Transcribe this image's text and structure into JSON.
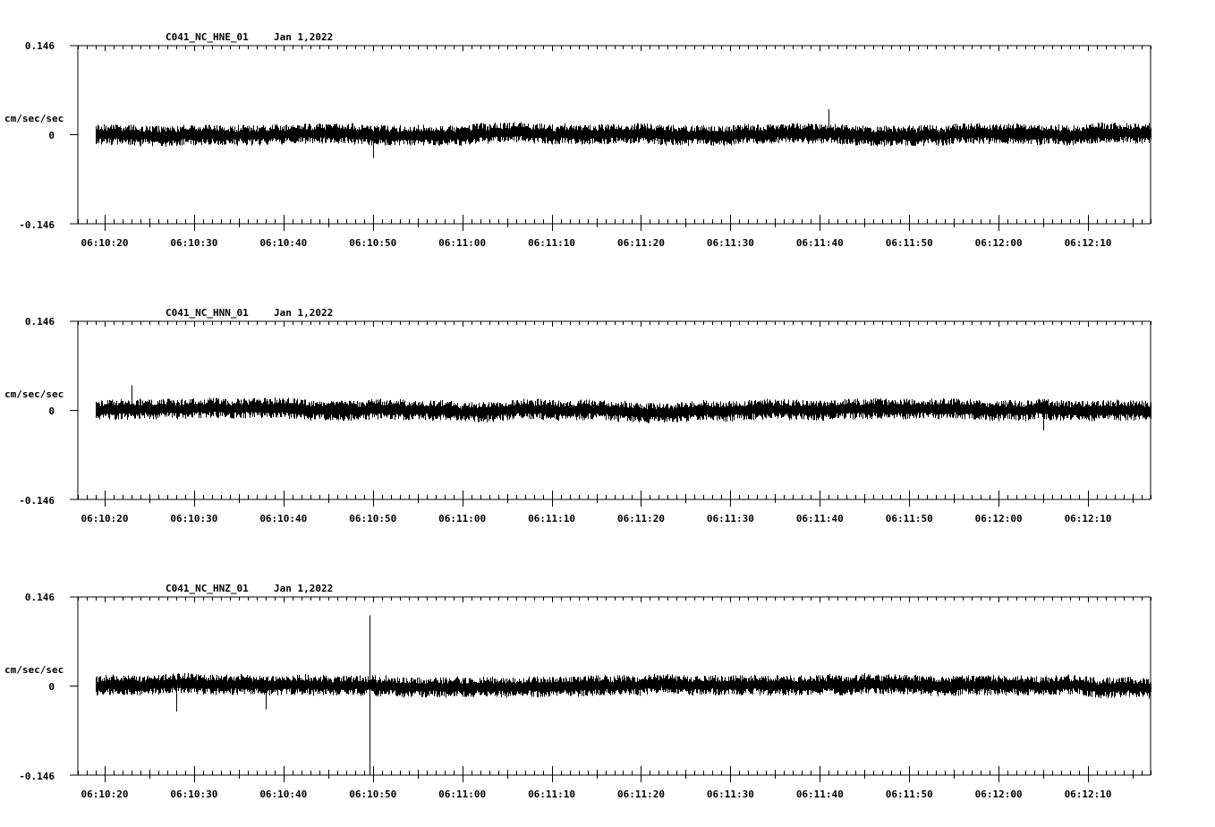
{
  "panels": [
    {
      "station": "C041_NC_HNE_01",
      "date": "Jan 1,2022"
    },
    {
      "station": "C041_NC_HNN_01",
      "date": "Jan 1,2022"
    },
    {
      "station": "C041_NC_HNZ_01",
      "date": "Jan 1,2022"
    }
  ],
  "chart_data": [
    {
      "type": "line",
      "title": "C041_NC_HNE_01   Jan 1,2022",
      "ylabel": "cm/sec/sec",
      "yticks": [
        "0.146",
        "0",
        "-0.146"
      ],
      "ylim": [
        -0.146,
        0.146
      ],
      "xlim": [
        "06:10:17",
        "06:12:17"
      ],
      "xticks": [
        "06:10:20",
        "06:10:30",
        "06:10:40",
        "06:10:50",
        "06:11:00",
        "06:11:10",
        "06:11:20",
        "06:11:30",
        "06:11:40",
        "06:11:50",
        "06:12:00",
        "06:12:10"
      ],
      "series": [
        {
          "start": "06:10:19",
          "end": "06:12:17",
          "noise_amplitude": 0.017,
          "peak_positive": 0.043,
          "peak_negative": -0.04
        }
      ],
      "spikes": [
        {
          "t": "06:11:41",
          "value": 0.042
        },
        {
          "t": "06:10:50",
          "value": -0.038
        }
      ]
    },
    {
      "type": "line",
      "title": "C041_NC_HNN_01   Jan 1,2022",
      "ylabel": "cm/sec/sec",
      "yticks": [
        "0.146",
        "0",
        "-0.146"
      ],
      "ylim": [
        -0.146,
        0.146
      ],
      "xlim": [
        "06:10:17",
        "06:12:17"
      ],
      "xticks": [
        "06:10:20",
        "06:10:30",
        "06:10:40",
        "06:10:50",
        "06:11:00",
        "06:11:10",
        "06:11:20",
        "06:11:30",
        "06:11:40",
        "06:11:50",
        "06:12:00",
        "06:12:10"
      ],
      "series": [
        {
          "start": "06:10:19",
          "end": "06:12:17",
          "noise_amplitude": 0.017,
          "peak_positive": 0.041,
          "peak_negative": -0.033
        }
      ],
      "spikes": [
        {
          "t": "06:10:23",
          "value": 0.041
        },
        {
          "t": "06:12:05",
          "value": -0.033
        }
      ]
    },
    {
      "type": "line",
      "title": "C041_NC_HNZ_01   Jan 1,2022",
      "ylabel": "cm/sec/sec",
      "yticks": [
        "0.146",
        "0",
        "-0.146"
      ],
      "ylim": [
        -0.146,
        0.146
      ],
      "xlim": [
        "06:10:17",
        "06:12:17"
      ],
      "xticks": [
        "06:10:20",
        "06:10:30",
        "06:10:40",
        "06:10:50",
        "06:11:00",
        "06:11:10",
        "06:11:20",
        "06:11:30",
        "06:11:40",
        "06:11:50",
        "06:12:00",
        "06:12:10"
      ],
      "series": [
        {
          "start": "06:10:19",
          "end": "06:12:17",
          "noise_amplitude": 0.017,
          "peak_positive": 0.116,
          "peak_negative": -0.146
        }
      ],
      "spikes": [
        {
          "t": "06:10:49.6",
          "value": 0.116
        },
        {
          "t": "06:10:49.6",
          "value": -0.146
        },
        {
          "t": "06:10:28",
          "value": -0.042
        },
        {
          "t": "06:10:38",
          "value": -0.038
        }
      ]
    }
  ]
}
